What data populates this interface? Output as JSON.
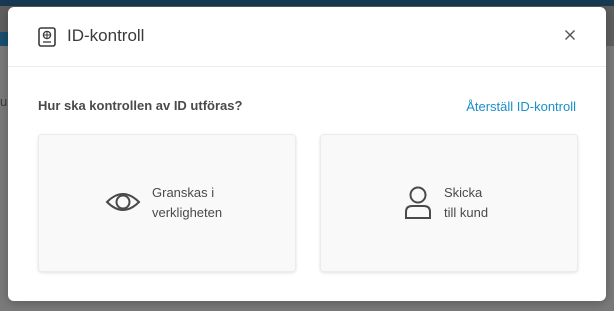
{
  "background": {
    "partial_text": "u"
  },
  "dialog": {
    "title": "ID-kontroll",
    "question": "Hur ska kontrollen av ID utföras?",
    "reset_link": "Återställ ID-kontroll",
    "options": [
      {
        "line1": "Granskas i",
        "line2": "verkligheten",
        "icon": "eye-icon"
      },
      {
        "line1": "Skicka",
        "line2": "till kund",
        "icon": "person-icon"
      }
    ]
  },
  "icons": {
    "header": "id-card-icon",
    "close": "close-icon"
  },
  "colors": {
    "link": "#1a8fc9",
    "text": "#4a4a4a",
    "overlay": "#7d7d7d",
    "background_accent": "#173a52"
  }
}
